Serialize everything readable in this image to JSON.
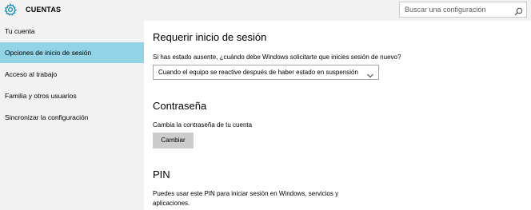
{
  "header": {
    "title": "CUENTAS",
    "app_icon": "gear-icon",
    "search": {
      "placeholder": "Buscar una configuración",
      "icon": "search-icon"
    }
  },
  "sidebar": {
    "items": [
      {
        "label": "Tu cuenta",
        "selected": false
      },
      {
        "label": "Opciones de inicio de sesión",
        "selected": true
      },
      {
        "label": "Acceso al trabajo",
        "selected": false
      },
      {
        "label": "Familia y otros usuarios",
        "selected": false
      },
      {
        "label": "Sincronizar la configuración",
        "selected": false
      }
    ]
  },
  "main": {
    "require_signin": {
      "title": "Requerir inicio de sesión",
      "description": "Si has estado ausente, ¿cuándo debe Windows solicitarte que inicies sesión de nuevo?",
      "dropdown_value": "Cuando el equipo se reactive después de haber estado en suspensión"
    },
    "password": {
      "title": "Contraseña",
      "description": "Cambia la contraseña de tu cuenta",
      "button_label": "Cambiar"
    },
    "pin": {
      "title": "PIN",
      "description_line1": "Puedes usar este PIN para iniciar sesión en Windows, servicios y",
      "description_line2": "aplicaciones."
    }
  },
  "colors": {
    "sidebar_bg": "#f2f2f2",
    "selected_item": "#92d3e5",
    "accent": "#1a8ab4",
    "button_bg": "#cccccc"
  }
}
